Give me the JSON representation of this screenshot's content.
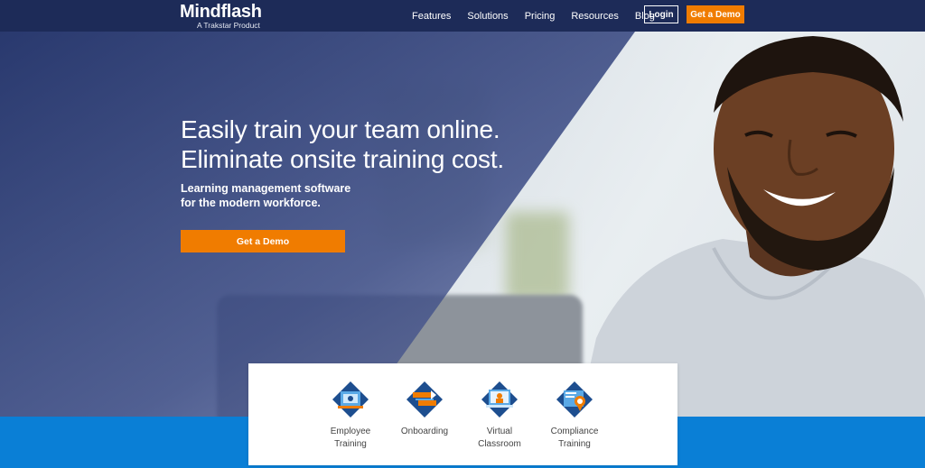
{
  "header": {
    "logo": "Mindflash",
    "logo_tagline": "A Trakstar Product",
    "nav": [
      {
        "label": "Features"
      },
      {
        "label": "Solutions"
      },
      {
        "label": "Pricing"
      },
      {
        "label": "Resources"
      },
      {
        "label": "Blog"
      }
    ],
    "login_label": "Login",
    "demo_label": "Get a Demo"
  },
  "hero": {
    "headline_line1": "Easily train your team online.",
    "headline_line2": "Eliminate onsite training cost.",
    "subheadline_line1": "Learning management software",
    "subheadline_line2": "for the modern workforce.",
    "cta_label": "Get a Demo"
  },
  "features": [
    {
      "line1": "Employee",
      "line2": "Training",
      "icon": "employee-training-icon"
    },
    {
      "line1": "Onboarding",
      "line2": "",
      "icon": "onboarding-icon"
    },
    {
      "line1": "Virtual",
      "line2": "Classroom",
      "icon": "virtual-classroom-icon"
    },
    {
      "line1": "Compliance",
      "line2": "Training",
      "icon": "compliance-training-icon"
    }
  ],
  "colors": {
    "header_bg": "#1d2b58",
    "accent_orange": "#f07c00",
    "band_blue": "#0a7fd6",
    "hero_overlay": "#2a3a72"
  }
}
